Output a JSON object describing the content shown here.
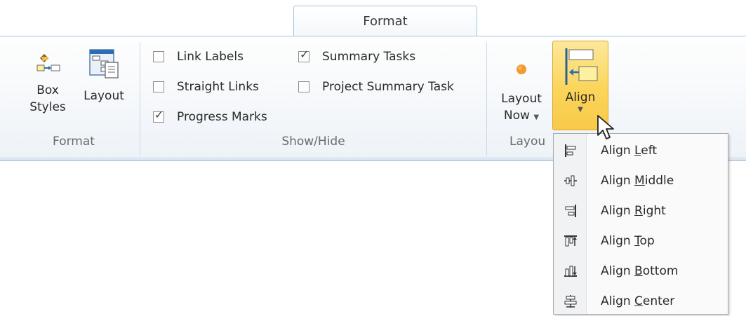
{
  "ribbon": {
    "active_tab": "Format",
    "groups": {
      "format": {
        "label": "Format",
        "box_styles_line1": "Box",
        "box_styles_line2": "Styles",
        "layout_label": "Layout"
      },
      "show_hide": {
        "label": "Show/Hide",
        "checkboxes": [
          {
            "label": "Link Labels",
            "checked": false
          },
          {
            "label": "Straight Links",
            "checked": false
          },
          {
            "label": "Progress Marks",
            "checked": true
          },
          {
            "label": "Summary Tasks",
            "checked": true
          },
          {
            "label": "Project Summary Task",
            "checked": false
          }
        ]
      },
      "layout": {
        "label": "Layou",
        "layout_now_line1": "Layout",
        "layout_now_line2": "Now",
        "align_label": "Align"
      }
    }
  },
  "align_menu": {
    "items": [
      {
        "prefix": "Align ",
        "key": "L",
        "suffix": "eft",
        "icon": "align-left-icon"
      },
      {
        "prefix": "Align ",
        "key": "M",
        "suffix": "iddle",
        "icon": "align-middle-icon"
      },
      {
        "prefix": "Align ",
        "key": "R",
        "suffix": "ight",
        "icon": "align-right-icon"
      },
      {
        "prefix": "Align ",
        "key": "T",
        "suffix": "op",
        "icon": "align-top-icon"
      },
      {
        "prefix": "Align ",
        "key": "B",
        "suffix": "ottom",
        "icon": "align-bottom-icon"
      },
      {
        "prefix": "Align ",
        "key": "C",
        "suffix": "enter",
        "icon": "align-center-icon"
      }
    ]
  },
  "colors": {
    "align_button_highlight": "#fbd55a",
    "layout_now_dot": "#f39a2a",
    "tab_border": "#9fc6e7"
  }
}
